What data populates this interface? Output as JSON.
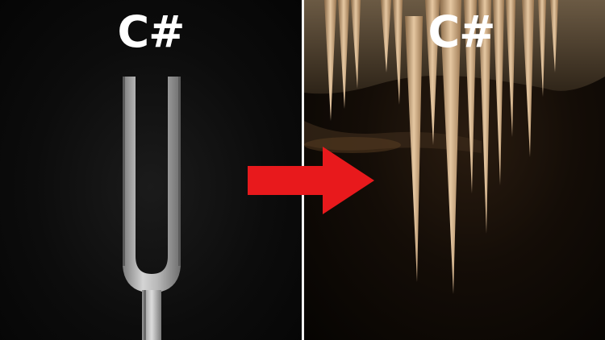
{
  "left_panel": {
    "note_label": "C#",
    "subject": "tuning-fork"
  },
  "right_panel": {
    "note_label": "C#",
    "subject": "stalactites"
  },
  "arrow": {
    "direction": "right",
    "color": "#e8191c"
  },
  "colors": {
    "divider": "#f2f2f2",
    "label": "#ffffff"
  }
}
